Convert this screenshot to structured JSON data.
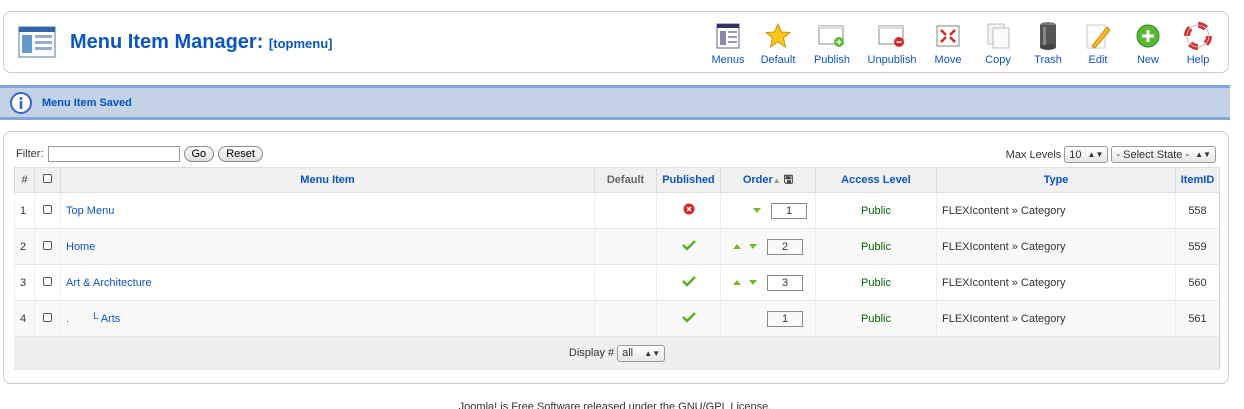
{
  "header": {
    "title": "Menu Item Manager:",
    "subtitle": "[topmenu]"
  },
  "toolbar": [
    {
      "key": "menus",
      "label": "Menus",
      "icon": "menus-icon"
    },
    {
      "key": "default",
      "label": "Default",
      "icon": "star-icon"
    },
    {
      "key": "publish",
      "label": "Publish",
      "icon": "publish-icon"
    },
    {
      "key": "unpublish",
      "label": "Unpublish",
      "icon": "unpublish-icon"
    },
    {
      "key": "move",
      "label": "Move",
      "icon": "move-icon"
    },
    {
      "key": "copy",
      "label": "Copy",
      "icon": "copy-icon"
    },
    {
      "key": "trash",
      "label": "Trash",
      "icon": "trash-icon"
    },
    {
      "key": "edit",
      "label": "Edit",
      "icon": "edit-icon"
    },
    {
      "key": "new",
      "label": "New",
      "icon": "new-icon"
    },
    {
      "key": "help",
      "label": "Help",
      "icon": "help-icon"
    }
  ],
  "message": "Menu Item Saved",
  "filter": {
    "label": "Filter:",
    "value": "",
    "go": "Go",
    "reset": "Reset"
  },
  "levels": {
    "label": "Max Levels",
    "value": "10",
    "state": "- Select State -"
  },
  "columns": {
    "num": "#",
    "menu_item": "Menu Item",
    "default": "Default",
    "published": "Published",
    "order": "Order",
    "access": "Access Level",
    "type": "Type",
    "itemid": "ItemID"
  },
  "rows": [
    {
      "num": "1",
      "name": "Top Menu",
      "prefix": "",
      "published": false,
      "up": false,
      "down": true,
      "order": "1",
      "access": "Public",
      "type": "FLEXIcontent » Category",
      "itemid": "558"
    },
    {
      "num": "2",
      "name": "Home",
      "prefix": "",
      "published": true,
      "up": true,
      "down": true,
      "order": "2",
      "access": "Public",
      "type": "FLEXIcontent » Category",
      "itemid": "559"
    },
    {
      "num": "3",
      "name": "Art & Architecture",
      "prefix": "",
      "published": true,
      "up": true,
      "down": true,
      "order": "3",
      "access": "Public",
      "type": "FLEXIcontent » Category",
      "itemid": "560"
    },
    {
      "num": "4",
      "name": "Arts",
      "prefix": ".       └ ",
      "published": true,
      "up": false,
      "down": false,
      "order": "1",
      "access": "Public",
      "type": "FLEXIcontent » Category",
      "itemid": "561"
    }
  ],
  "pagination": {
    "display_label": "Display #",
    "display_value": "all"
  },
  "footer": "Joomla! is Free Software released under the GNU/GPL License."
}
